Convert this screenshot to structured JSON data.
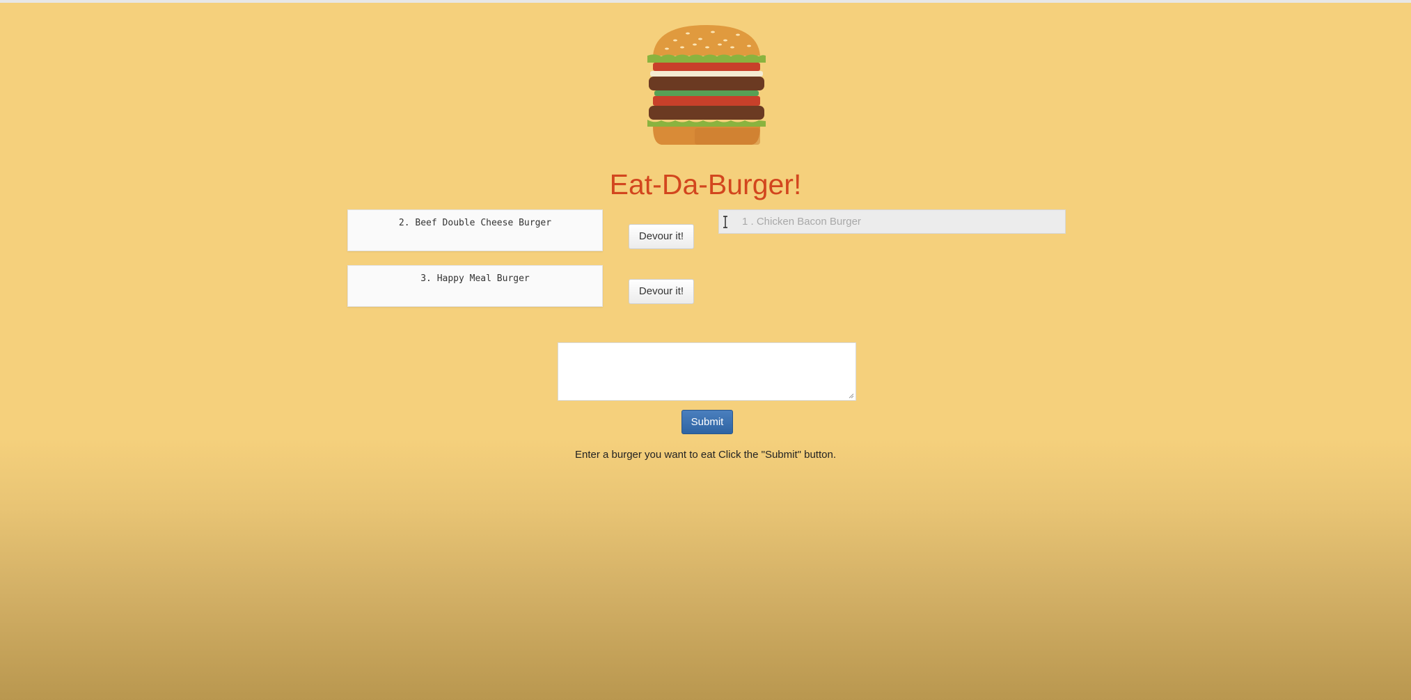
{
  "header": {
    "title": "Eat-Da-Burger!"
  },
  "burgers_to_eat": [
    {
      "label": "2. Beef Double Cheese Burger",
      "button_label": "Devour it!"
    },
    {
      "label": "3. Happy Meal Burger",
      "button_label": "Devour it!"
    }
  ],
  "devoured": [
    {
      "label": "1 . Chicken Bacon Burger"
    }
  ],
  "form": {
    "textarea_value": "",
    "submit_label": "Submit",
    "instructions": "Enter a burger you want to eat Click the \"Submit\" button."
  },
  "colors": {
    "background": "#f5d07c",
    "title": "#d2461e",
    "submit_button": "#3a6fb0"
  },
  "icons": {
    "logo": "burger-logo-icon",
    "cursor": "text-cursor-icon",
    "resize": "resize-grip-icon"
  }
}
